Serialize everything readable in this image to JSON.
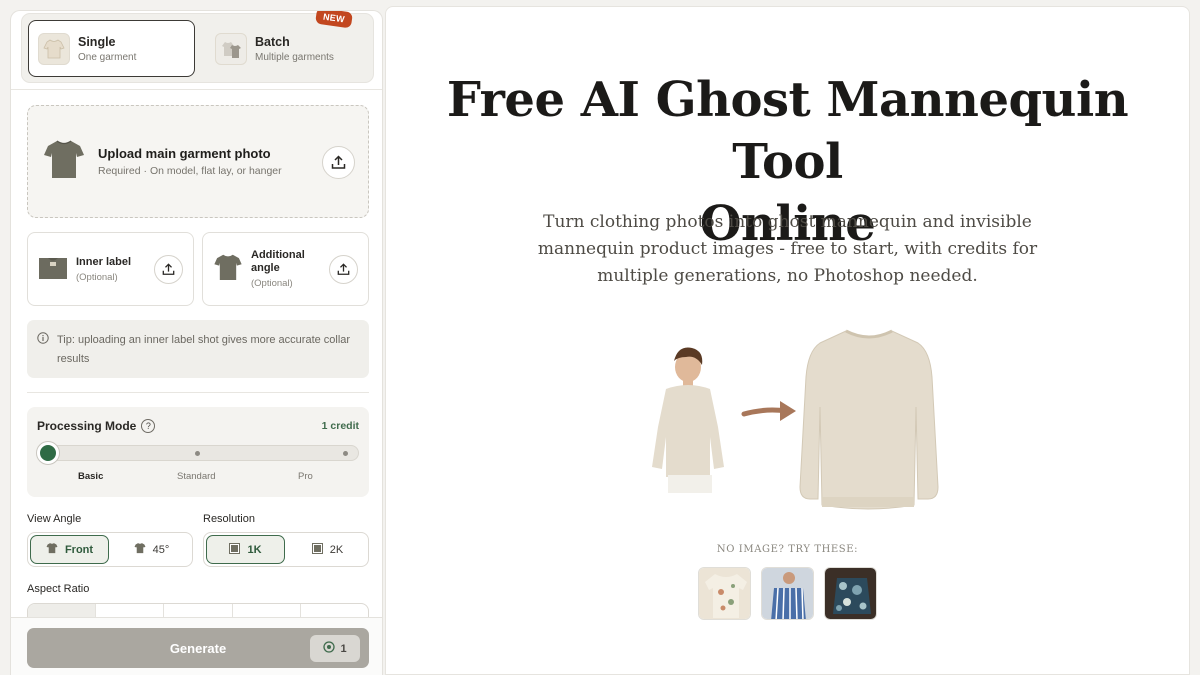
{
  "mode": {
    "single": {
      "title": "Single",
      "subtitle": "One garment"
    },
    "batch": {
      "title": "Batch",
      "subtitle": "Multiple garments",
      "badge": "NEW"
    }
  },
  "upload": {
    "main_title": "Upload main garment photo",
    "main_subtitle": "Required · On model, flat lay, or hanger",
    "inner_label": {
      "title": "Inner label",
      "subtitle": "(Optional)"
    },
    "additional_angle": {
      "title_line1": "Additional",
      "title_line2": "angle",
      "subtitle": "(Optional)"
    }
  },
  "tip": "Tip: uploading an inner label shot gives more accurate collar results",
  "processing": {
    "title": "Processing Mode",
    "help": "?",
    "credit": "1 credit",
    "levels": [
      "Basic",
      "Standard",
      "Pro"
    ],
    "selected_level": "Basic"
  },
  "view_angle": {
    "label": "View Angle",
    "options": [
      "Front",
      "45°"
    ],
    "selected": "Front"
  },
  "resolution": {
    "label": "Resolution",
    "options": [
      "1K",
      "2K"
    ],
    "selected": "1K"
  },
  "aspect_ratio": {
    "label": "Aspect Ratio"
  },
  "generate": {
    "label": "Generate",
    "credits": "1"
  },
  "hero": {
    "title_line1": "Free AI Ghost Mannequin Tool",
    "title_line2": "Online",
    "subtitle": "Turn clothing photos into ghost mannequin and invisible mannequin product images - free to start, with credits for multiple generations, no Photoshop needed."
  },
  "samples": {
    "label": "NO IMAGE? TRY THESE:"
  },
  "colors": {
    "accent_green": "#2f6b45",
    "badge": "#c2471f",
    "garment": "#e4dccd"
  }
}
